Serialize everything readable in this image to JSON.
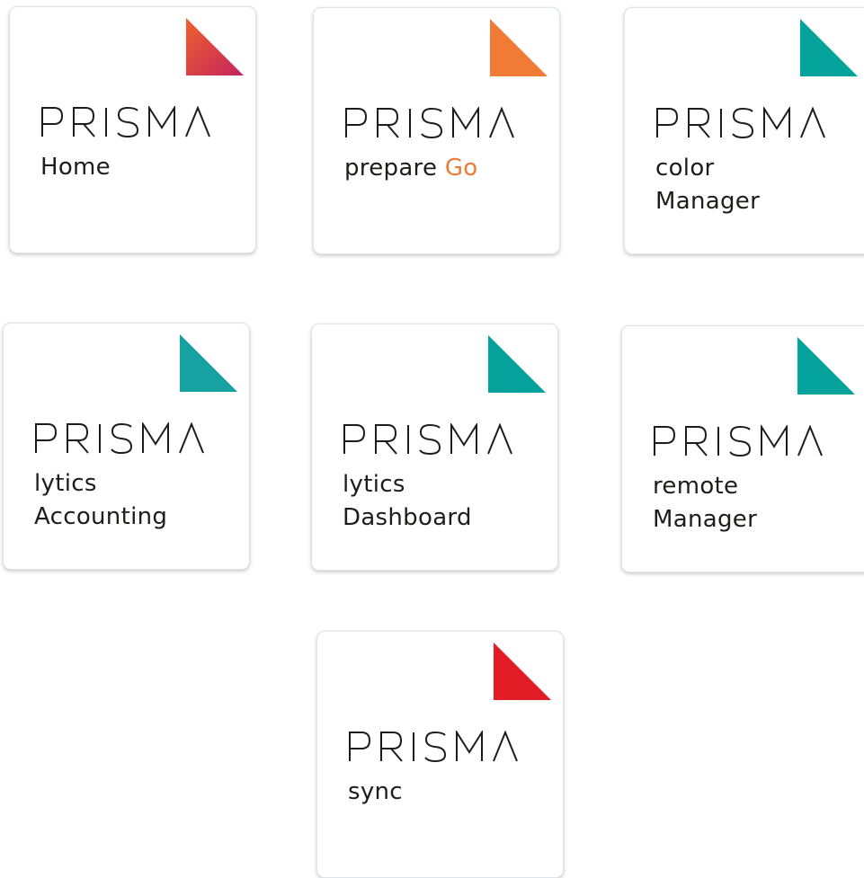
{
  "colors": {
    "home_gradient": [
      "#f0612c",
      "#c3245d"
    ],
    "prepare_go": "#f07b36",
    "teal": "#04a39b",
    "teal_lytics": "#16a2a0",
    "sync_red": "#e21d26",
    "text": "#1d1d1b"
  },
  "brand": "PRISMA",
  "tiles": [
    {
      "lines": [
        "Home"
      ],
      "icon": "gradient-triangle-icon"
    },
    {
      "line1": "prepare",
      "line1_accent": "Go",
      "icon": "orange-triangle-icon"
    },
    {
      "lines": [
        "color",
        "Manager"
      ],
      "icon": "teal-triangle-icon"
    },
    {
      "lines": [
        "lytics",
        "Accounting"
      ],
      "icon": "teal-triangle-icon"
    },
    {
      "lines": [
        "lytics",
        "Dashboard"
      ],
      "icon": "teal-triangle-icon"
    },
    {
      "lines": [
        "remote",
        "Manager"
      ],
      "icon": "teal-triangle-icon"
    },
    {
      "lines": [
        "sync"
      ],
      "icon": "red-triangle-icon"
    }
  ]
}
